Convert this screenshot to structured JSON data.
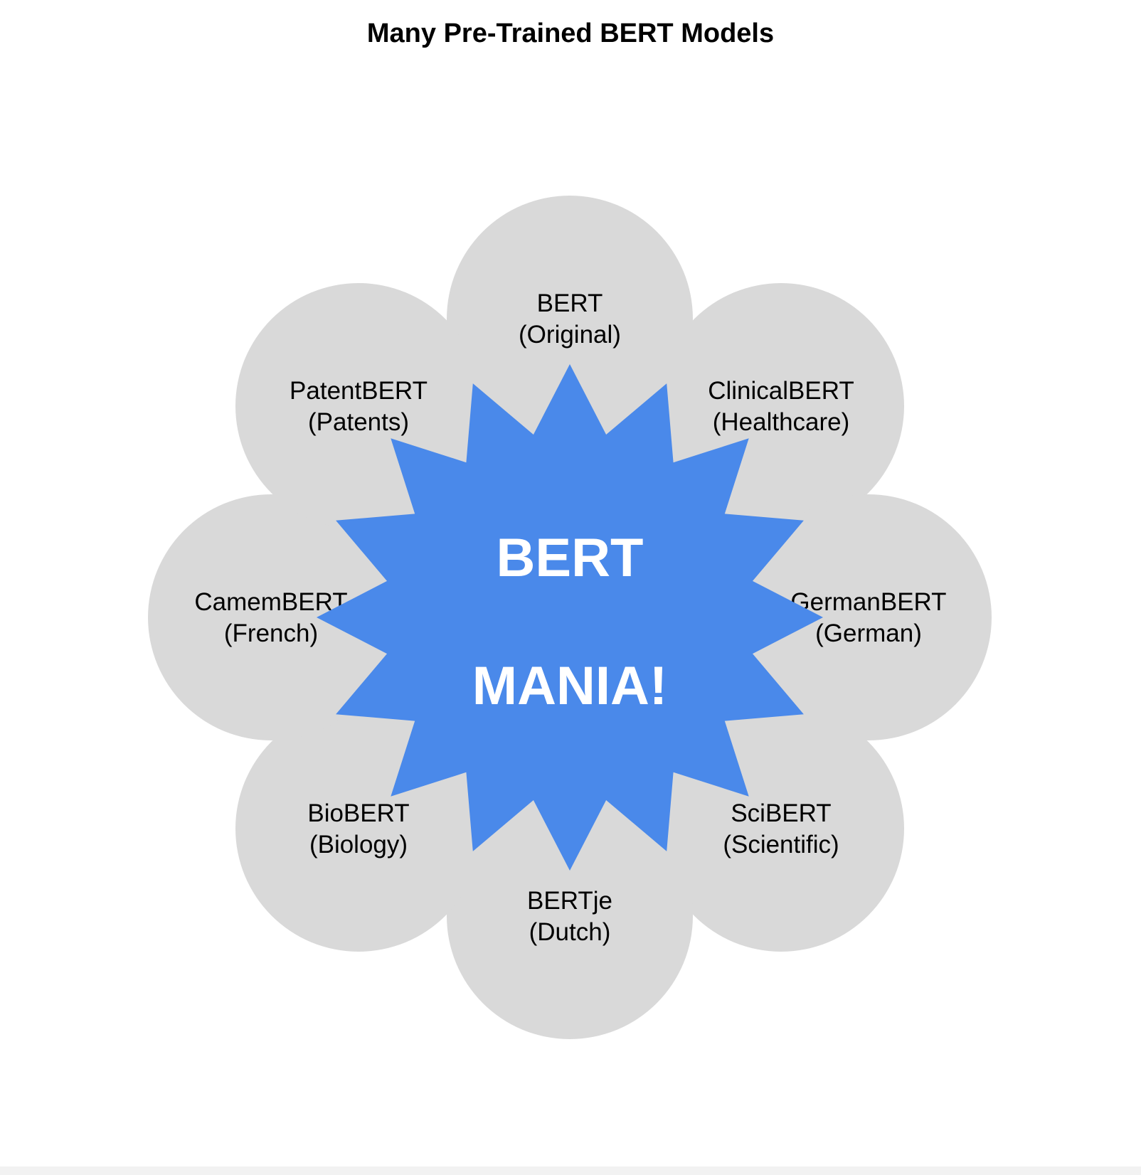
{
  "title": "Many Pre-Trained BERT Models",
  "center": {
    "line1": "BERT",
    "line2": "MANIA!",
    "color": "#4a89ea"
  },
  "node_color": "#d9d9d9",
  "arrow_color": "#000000",
  "nodes": [
    {
      "name": "BERT",
      "detail": "(Original)"
    },
    {
      "name": "ClinicalBERT",
      "detail": "(Healthcare)"
    },
    {
      "name": "GermanBERT",
      "detail": "(German)"
    },
    {
      "name": "SciBERT",
      "detail": "(Scientific)"
    },
    {
      "name": "BERTje",
      "detail": "(Dutch)"
    },
    {
      "name": "BioBERT",
      "detail": "(Biology)"
    },
    {
      "name": "CamemBERT",
      "detail": "(French)"
    },
    {
      "name": "PatentBERT",
      "detail": "(Patents)"
    }
  ]
}
